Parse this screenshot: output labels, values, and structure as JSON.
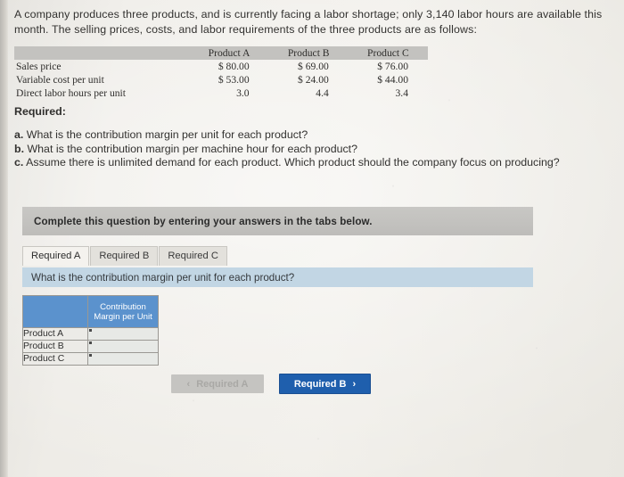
{
  "problem": {
    "intro": "A company produces three products, and is currently facing a labor shortage; only 3,140 labor hours are available this month. The selling prices, costs, and labor requirements of the three products are as follows:",
    "table": {
      "corner_label": "",
      "columns": [
        "Product A",
        "Product B",
        "Product C"
      ],
      "rows": [
        {
          "label": "Sales price",
          "values": [
            "$ 80.00",
            "$ 69.00",
            "$ 76.00"
          ]
        },
        {
          "label": "Variable cost per unit",
          "values": [
            "$ 53.00",
            "$ 24.00",
            "$ 44.00"
          ]
        },
        {
          "label": "Direct labor hours per unit",
          "values": [
            "3.0",
            "4.4",
            "3.4"
          ]
        }
      ]
    },
    "required_heading": "Required:",
    "required_items": [
      {
        "marker": "a.",
        "text": "What is the contribution margin per unit for each product?"
      },
      {
        "marker": "b.",
        "text": "What is the contribution margin per machine hour for each product?"
      },
      {
        "marker": "c.",
        "text": "Assume there is unlimited demand for each product. Which product should the company focus on producing?"
      }
    ]
  },
  "answer_panel": {
    "banner_text": "Complete this question by entering your answers in the tabs below.",
    "tabs": [
      {
        "label": "Required A",
        "active": true
      },
      {
        "label": "Required B",
        "active": false
      },
      {
        "label": "Required C",
        "active": false
      }
    ],
    "question_text": "What is the contribution margin per unit for each product?",
    "grid": {
      "corner_label": "",
      "column_header": "Contribution Margin per Unit",
      "rows": [
        {
          "label": "Product A",
          "value": ""
        },
        {
          "label": "Product B",
          "value": ""
        },
        {
          "label": "Product C",
          "value": ""
        }
      ]
    },
    "nav": {
      "prev_label": "Required A",
      "prev_chevron": "‹",
      "prev_disabled": true,
      "next_label": "Required B",
      "next_chevron": "›"
    }
  },
  "colors": {
    "page_background": "#eeece7",
    "table_header_gray": "#c3c2bf",
    "banner_gray": "#c5c4c1",
    "question_blue": "#c2d6e4",
    "grid_header_blue": "#5b92cd",
    "primary_button_blue": "#1f5fad",
    "disabled_button_gray": "#c5c4c1"
  }
}
